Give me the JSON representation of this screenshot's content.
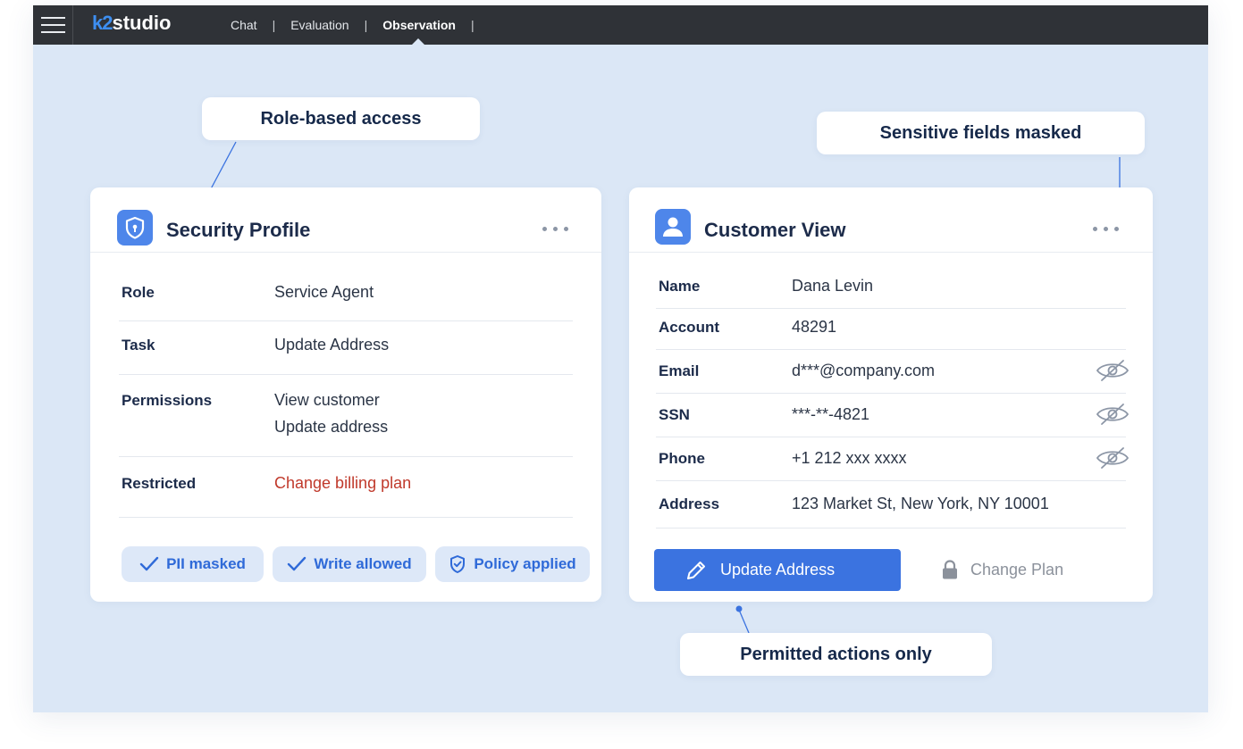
{
  "app": {
    "logo_prefix": "k2",
    "logo_suffix": "studio",
    "nav": [
      {
        "label": "Chat",
        "active": false
      },
      {
        "label": "Evaluation",
        "active": false
      },
      {
        "label": "Observation",
        "active": true
      }
    ],
    "separator": "|"
  },
  "callouts": {
    "role_based": "Role-based access",
    "sensitive": "Sensitive fields masked",
    "permitted": "Permitted actions only"
  },
  "security_profile": {
    "title": "Security Profile",
    "icon": "shield-lock-icon",
    "rows": [
      {
        "label": "Role",
        "value": "Service Agent"
      },
      {
        "label": "Task",
        "value": "Update Address"
      },
      {
        "label": "Permissions",
        "value": "View customer",
        "value2": "Update address"
      },
      {
        "label": "Restricted",
        "value": "Change billing plan"
      }
    ],
    "chips": [
      {
        "label": "PII masked",
        "icon": "check-icon"
      },
      {
        "label": "Write allowed",
        "icon": "check-icon"
      },
      {
        "label": "Policy applied",
        "icon": "shield-check-icon"
      }
    ]
  },
  "customer_view": {
    "title": "Customer View",
    "icon": "user-icon",
    "rows": [
      {
        "label": "Name",
        "value": "Dana Levin",
        "masked": false
      },
      {
        "label": "Account",
        "value": "48291",
        "masked": false
      },
      {
        "label": "Email",
        "value": "d***@company.com",
        "masked": true
      },
      {
        "label": "SSN",
        "value": "***-**-4821",
        "masked": true
      },
      {
        "label": "Phone",
        "value": "+1 212 xxx xxxx",
        "masked": true
      },
      {
        "label": "Address",
        "value": "123 Market St, New York, NY 10001",
        "masked": false
      }
    ],
    "primary_action": "Update Address",
    "disabled_action": "Change Plan"
  },
  "colors": {
    "accent": "#3b73e0",
    "background": "#dbe7f6",
    "topbar": "#2f3237",
    "restricted": "#c0392b",
    "chip_bg": "#dde8f8"
  }
}
